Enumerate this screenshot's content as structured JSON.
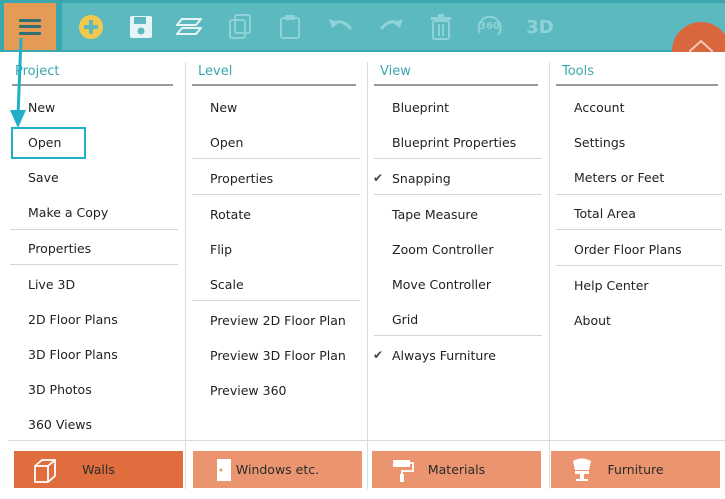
{
  "toolbar": {
    "label_360": "360",
    "label_3d": "3D"
  },
  "columns": {
    "project": {
      "title": "Project",
      "items": [
        "New",
        "Open",
        "Save",
        "Make a Copy",
        "Properties",
        "Live 3D",
        "2D Floor Plans",
        "3D Floor Plans",
        "3D Photos",
        "360 Views"
      ]
    },
    "level": {
      "title": "Level",
      "items": [
        "New",
        "Open",
        "Properties",
        "Rotate",
        "Flip",
        "Scale",
        "Preview 2D Floor Plan",
        "Preview 3D Floor Plan",
        "Preview 360"
      ]
    },
    "view": {
      "title": "View",
      "items": [
        "Blueprint",
        "Blueprint Properties",
        "Snapping",
        "Tape Measure",
        "Zoom Controller",
        "Move Controller",
        "Grid",
        "Always Furniture"
      ]
    },
    "tools": {
      "title": "Tools",
      "items": [
        "Account",
        "Settings",
        "Meters or Feet",
        "Total Area",
        "Order Floor Plans",
        "Help Center",
        "About"
      ]
    }
  },
  "check_mark": "✔",
  "bottom": {
    "walls": "Walls",
    "windows": "Windows etc.",
    "materials": "Materials",
    "furniture": "Furniture"
  },
  "colors": {
    "toolbar": "#3aa7ae",
    "accent": "#3aa7ae",
    "menu_button": "#e39b55",
    "walls_active": "#e06d3d",
    "bottom_button": "#eb9470",
    "highlight": "#1fb0c8"
  }
}
